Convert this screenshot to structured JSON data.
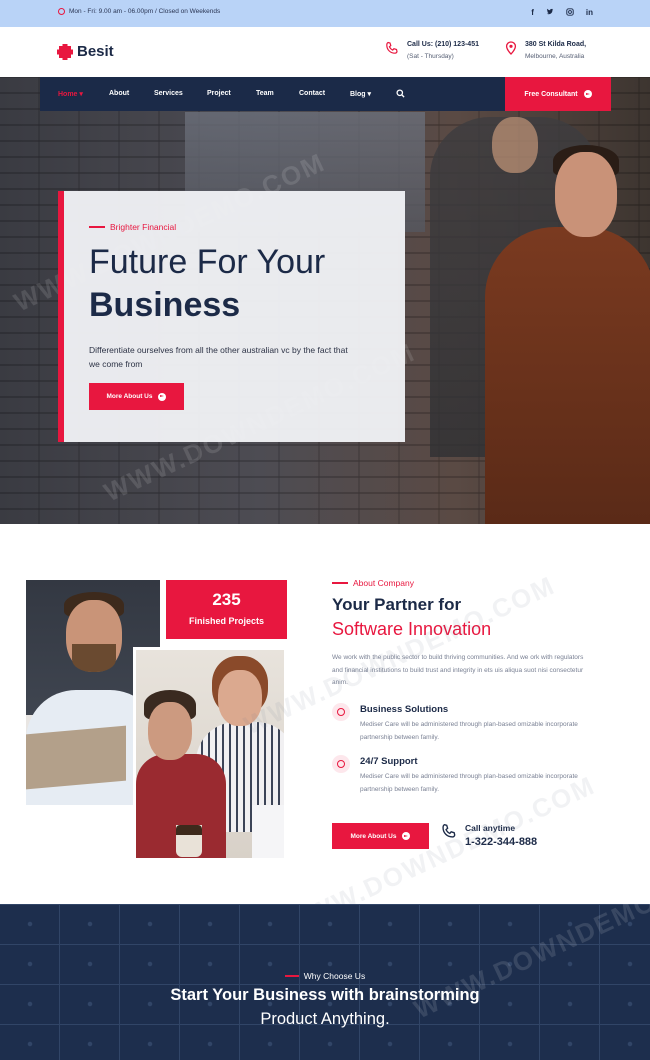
{
  "topbar": {
    "hours": "Mon - Fri: 9.00 am - 06.00pm / Closed on Weekends",
    "socials": [
      "f",
      "t",
      "ig",
      "in"
    ]
  },
  "header": {
    "logo_text": "Besit",
    "call_label": "Call Us: (210) 123-451",
    "call_hours": "(Sat - Thursday)",
    "address_line1": "380 St Kilda Road,",
    "address_line2": "Melbourne, Australia"
  },
  "nav": {
    "items": [
      {
        "label": "Home",
        "active": true
      },
      {
        "label": "About"
      },
      {
        "label": "Services"
      },
      {
        "label": "Project"
      },
      {
        "label": "Team"
      },
      {
        "label": "Contact"
      },
      {
        "label": "Blog"
      }
    ],
    "cta": "Free Consultant"
  },
  "hero": {
    "eyebrow": "Brighter Financial",
    "title_line1": "Future For Your",
    "title_line2": "Business",
    "description": "Differentiate ourselves from all the other australian vc by the fact that we come from",
    "button": "More About Us"
  },
  "about": {
    "counter_value": "235",
    "counter_label": "Finished Projects",
    "eyebrow": "About Company",
    "title_line1": "Your Partner for",
    "title_line2": "Software Innovation",
    "description": "We work with the public sector to build thriving communities. And we ork with regulators and financial institutions to build trust and integrity in ets uis aliqua suot nisi consectetur anim.",
    "features": [
      {
        "title": "Business Solutions",
        "text": "Mediser Care will be administered through plan-based omizable incorporate partnership between family."
      },
      {
        "title": "24/7 Support",
        "text": "Mediser Care will be administered through plan-based omizable incorporate partnership between family."
      }
    ],
    "button": "More About Us",
    "call_label": "Call anytime",
    "call_number": "1-322-344-888"
  },
  "why": {
    "eyebrow": "Why Choose Us",
    "title_line1": "Start Your Business with brainstorming",
    "title_line2": "Product Anything."
  },
  "watermark": "WWW.DOWNDEMO.COM",
  "colors": {
    "accent": "#e8173f",
    "navy": "#1b2a48",
    "topbar": "#b9d3f7"
  }
}
